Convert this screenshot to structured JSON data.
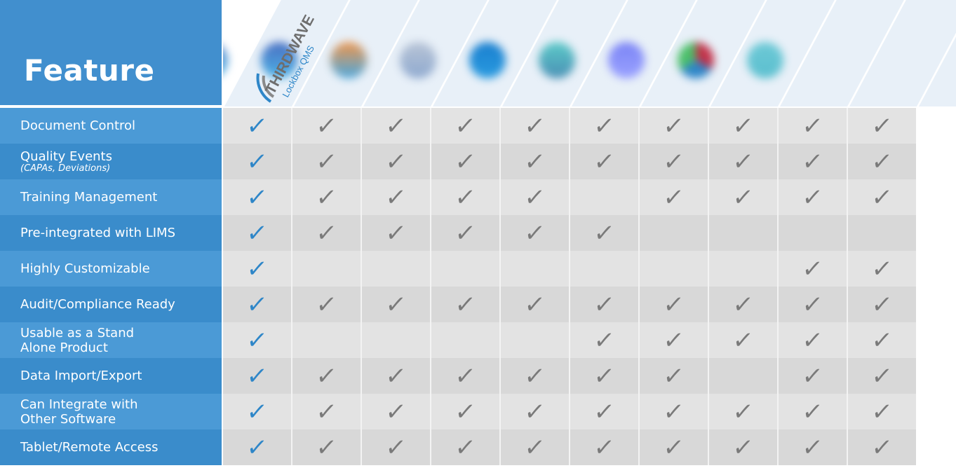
{
  "header": {
    "feature_label": "Feature",
    "brand": {
      "name_top": "THIRDWAVE",
      "name_sub": "Lockbox QMS",
      "color_primary": "#2e86c8",
      "color_gray": "#7a7a7a"
    },
    "competitor_logos": [
      {
        "icon": "blurred-triangle-logo-icon",
        "colors": [
          "#6b8fcf",
          "#4db3e6"
        ]
      },
      {
        "icon": "blurred-ring-logo-icon",
        "colors": [
          "#4a6fc2",
          "#4db3e6"
        ]
      },
      {
        "icon": "blurred-square-logo-icon",
        "colors": [
          "#f0954a",
          "#4aa8e0"
        ]
      },
      {
        "icon": "blurred-flask-logo-icon",
        "colors": [
          "#b8c4d6",
          "#8ea9cf"
        ]
      },
      {
        "icon": "blurred-circle-logo-icon",
        "colors": [
          "#1a7fcf",
          "#2a9be0"
        ]
      },
      {
        "icon": "blurred-teal-ring-logo-icon",
        "colors": [
          "#5ccac8",
          "#4a8fb5"
        ]
      },
      {
        "icon": "blurred-violet-circle-logo-icon",
        "colors": [
          "#7b84f5",
          "#9aa2ff"
        ]
      },
      {
        "icon": "blurred-multicolor-logo-icon",
        "colors": [
          "#c2324a",
          "#2e86c8",
          "#4cbf6a"
        ]
      },
      {
        "icon": "blurred-teal-wordmark-icon",
        "colors": [
          "#6dc9d6",
          "#5bbfcf"
        ]
      }
    ]
  },
  "features": [
    {
      "label": "Document Control",
      "sub": "",
      "checks": [
        1,
        1,
        1,
        1,
        1,
        1,
        1,
        1,
        1,
        1
      ]
    },
    {
      "label": "Quality Events",
      "sub": "(CAPAs, Deviations)",
      "checks": [
        1,
        1,
        1,
        1,
        1,
        1,
        1,
        1,
        1,
        1
      ]
    },
    {
      "label": "Training Management",
      "sub": "",
      "checks": [
        1,
        1,
        1,
        1,
        1,
        0,
        1,
        1,
        1,
        1
      ]
    },
    {
      "label": "Pre-integrated with LIMS",
      "sub": "",
      "checks": [
        1,
        1,
        1,
        1,
        1,
        1,
        0,
        0,
        0,
        0
      ]
    },
    {
      "label": "Highly Customizable",
      "sub": "",
      "checks": [
        1,
        0,
        0,
        0,
        0,
        0,
        0,
        0,
        1,
        1
      ]
    },
    {
      "label": "Audit/Compliance Ready",
      "sub": "",
      "checks": [
        1,
        1,
        1,
        1,
        1,
        1,
        1,
        1,
        1,
        1
      ]
    },
    {
      "label": "Usable as a Stand\nAlone Product",
      "sub": "",
      "checks": [
        1,
        0,
        0,
        0,
        0,
        1,
        1,
        1,
        1,
        1
      ]
    },
    {
      "label": "Data Import/Export",
      "sub": "",
      "checks": [
        1,
        1,
        1,
        1,
        1,
        1,
        1,
        0,
        1,
        1
      ]
    },
    {
      "label": "Can Integrate with\nOther Software",
      "sub": "",
      "checks": [
        1,
        1,
        1,
        1,
        1,
        1,
        1,
        1,
        1,
        1
      ]
    },
    {
      "label": "Tablet/Remote Access",
      "sub": "",
      "checks": [
        1,
        1,
        1,
        1,
        1,
        1,
        1,
        1,
        1,
        1
      ]
    }
  ],
  "check_glyph": "✓"
}
